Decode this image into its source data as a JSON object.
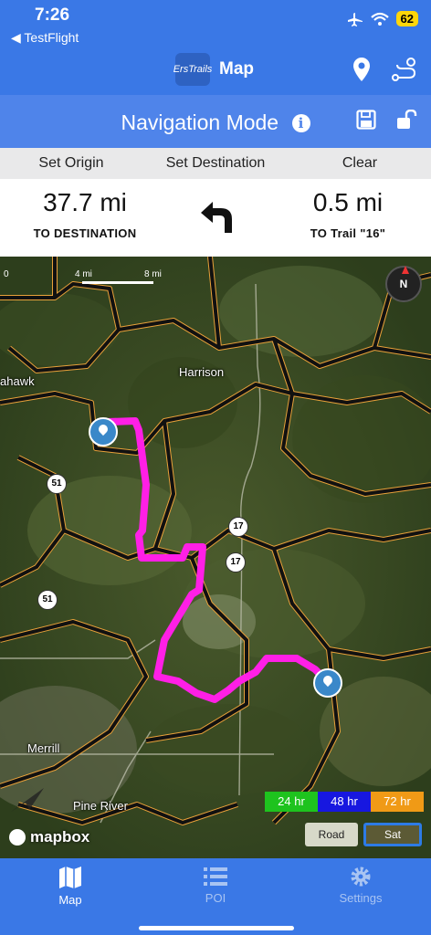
{
  "status": {
    "time": "7:26",
    "back_app": "◀ TestFlight",
    "battery": "62"
  },
  "header": {
    "title": "Map",
    "logo_text": "ErsTrails"
  },
  "navbar": {
    "title": "Navigation Mode",
    "info": "i"
  },
  "actions": {
    "set_origin": "Set Origin",
    "set_destination": "Set Destination",
    "clear": "Clear"
  },
  "distance": {
    "to_destination_value": "37.7 mi",
    "to_destination_label": "TO DESTINATION",
    "to_trail_value": "0.5 mi",
    "to_trail_label": "TO Trail \"16\""
  },
  "map": {
    "scale_0": "0",
    "scale_4": "4 mi",
    "scale_8": "8 mi",
    "compass": "N",
    "places": {
      "harrison": "Harrison",
      "hawk": "ahawk",
      "merrill": "Merrill",
      "pine_river": "Pine River"
    },
    "shields": {
      "us51_a": "51",
      "us51_b": "51",
      "r17_a": "17",
      "r17_b": "17"
    },
    "legend": {
      "h24": "24 hr",
      "h48": "48 hr",
      "h72": "72 hr"
    },
    "legend_colors": {
      "h24": "#1ec31e",
      "h48": "#1717e0",
      "h72": "#f09a16"
    },
    "map_type": {
      "road": "Road",
      "sat": "Sat",
      "selected": "Sat"
    },
    "attribution": "mapbox",
    "route_color": "#ff1fe6"
  },
  "tabs": {
    "map": "Map",
    "poi": "POI",
    "settings": "Settings",
    "active": "Map"
  }
}
